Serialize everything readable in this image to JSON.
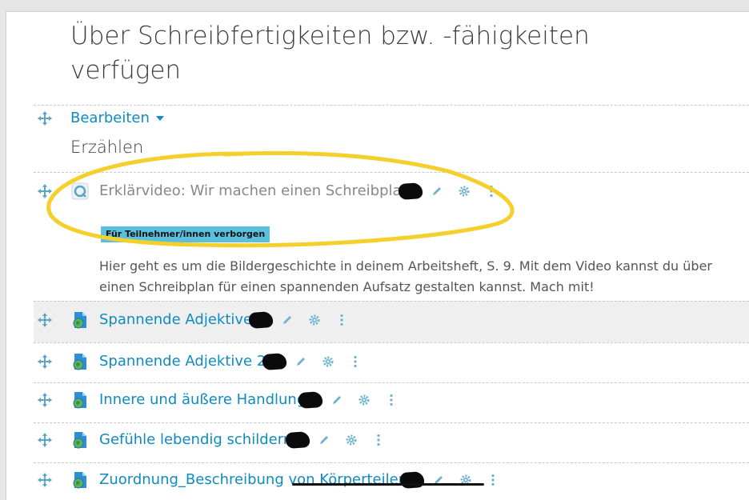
{
  "section": {
    "title": "Über Schreibfertigkeiten bzw. -fähigkeiten verfügen"
  },
  "edit_menu": {
    "label": "Bearbeiten"
  },
  "subheading": "Erzählen",
  "hidden_activity": {
    "title": "Erklärvideo: Wir machen einen Schreibplan!",
    "badge": "Für Teilnehmer/innen verborgen",
    "description_line1": "Hier geht es um die Bildergeschichte in deinem Arbeitsheft, S. 9. Mit dem Video kannst du über",
    "description_line2": "einen Schreibplan für einen spannenden Aufsatz gestalten kannst. Mach mit!"
  },
  "activities": [
    {
      "title": "Spannende Adjektive"
    },
    {
      "title": "Spannende Adjektive 2"
    },
    {
      "title": "Innere und äußere Handlung"
    },
    {
      "title": "Gefühle lebendig schildern"
    },
    {
      "title": "Zuordnung_Beschreibung von Körperteilen"
    }
  ],
  "colors": {
    "link": "#0f8bbf",
    "badge": "#5bc0de",
    "highlight_circle": "#f5cf2c"
  }
}
